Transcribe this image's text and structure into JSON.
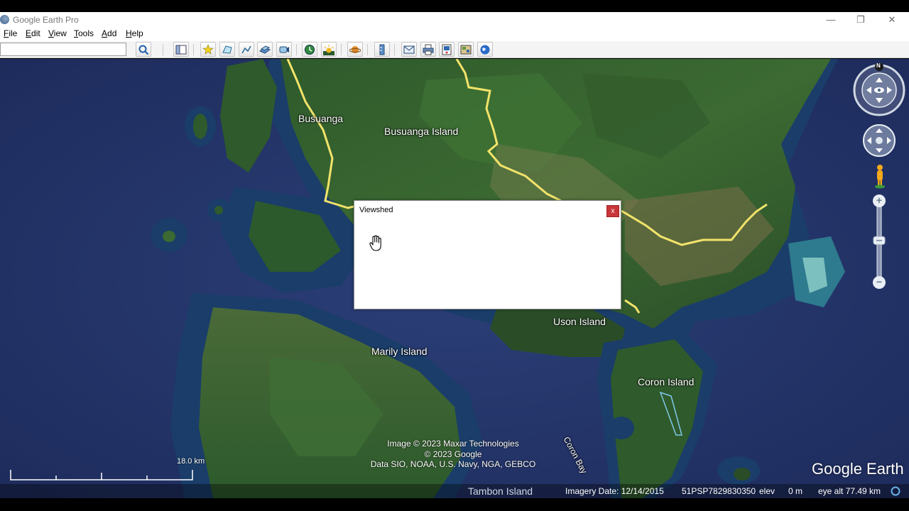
{
  "window": {
    "title": "Google Earth Pro",
    "minimize": "—",
    "restore": "❐",
    "close": "✕"
  },
  "menu": {
    "file": {
      "first": "F",
      "rest": "ile"
    },
    "edit": {
      "first": "E",
      "rest": "dit"
    },
    "view": {
      "first": "V",
      "rest": "iew"
    },
    "tools": {
      "first": "T",
      "rest": "ools"
    },
    "add": {
      "first": "A",
      "rest": "dd"
    },
    "help": {
      "first": "H",
      "rest": "elp"
    }
  },
  "toolbar": {
    "search_value": "",
    "icons": [
      "search-icon",
      "sidebar-icon",
      "placemark-icon",
      "polygon-icon",
      "path-icon",
      "image-overlay-icon",
      "record-tour-icon",
      "historical-imagery-icon",
      "sunlight-icon",
      "planets-icon",
      "ruler-icon",
      "email-icon",
      "print-icon",
      "save-image-icon",
      "view-in-maps-icon",
      "earth-icon"
    ]
  },
  "map": {
    "labels": {
      "busuanga": "Busuanga",
      "busuanga_island": "Busuanga Island",
      "uson_island": "Uson Island",
      "marily_island": "Marily Island",
      "coron_island": "Coron Island",
      "coron_bay": "Coron Bay",
      "tambon_island": "Tambon Island"
    },
    "credits": {
      "line1": "Image © 2023 Maxar Technologies",
      "line2": "© 2023 Google",
      "line3": "Data SIO, NOAA, U.S. Navy, NGA, GEBCO"
    },
    "scale_label": "18.0 km",
    "logo": "Google Earth",
    "compass_north": "N",
    "zoom_in": "+",
    "zoom_out": "−",
    "zoom_level": 0.45
  },
  "status": {
    "imagery_date": "Imagery Date: 12/14/2015",
    "coordinates": "51PSP7829830350",
    "elev_label": "elev",
    "elev_value": "0 m",
    "eye_alt": "eye alt  77.49 km"
  },
  "dialog": {
    "title": "Viewshed",
    "close_label": "x"
  },
  "colors": {
    "ocean": "#25366b",
    "border_line": "#f2e36a",
    "dialog_close": "#c7363a"
  }
}
